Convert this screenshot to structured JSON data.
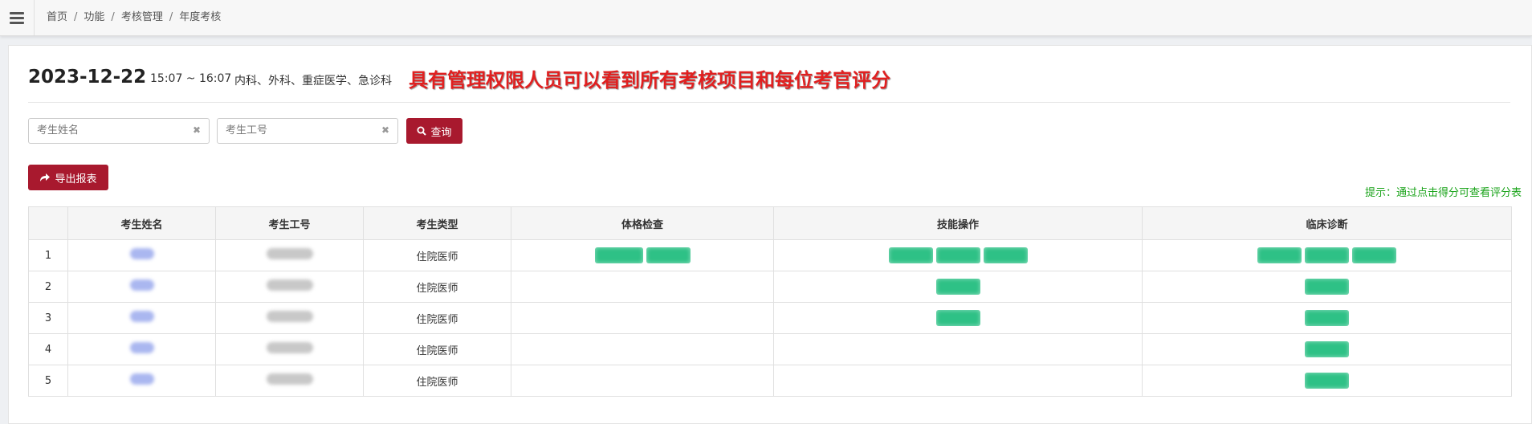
{
  "breadcrumb": [
    "首页",
    "功能",
    "考核管理",
    "年度考核"
  ],
  "exam": {
    "date": "2023-12-22",
    "time": "15:07 ~ 16:07",
    "departments": "内科、外科、重症医学、急诊科",
    "notice": "具有管理权限人员可以看到所有考核项目和每位考官评分"
  },
  "search": {
    "name_placeholder": "考生姓名",
    "id_placeholder": "考生工号",
    "query_label": "查询"
  },
  "export_label": "导出报表",
  "tip": "提示：通过点击得分可查看评分表",
  "table": {
    "headers": [
      "",
      "考生姓名",
      "考生工号",
      "考生类型",
      "体格检查",
      "技能操作",
      "临床诊断"
    ],
    "rows": [
      {
        "index": "1",
        "type": "住院医师",
        "physical": 2,
        "skills": 3,
        "clinical": 3
      },
      {
        "index": "2",
        "type": "住院医师",
        "physical": 0,
        "skills": 1,
        "clinical": 1
      },
      {
        "index": "3",
        "type": "住院医师",
        "physical": 0,
        "skills": 1,
        "clinical": 1
      },
      {
        "index": "4",
        "type": "住院医师",
        "physical": 0,
        "skills": 0,
        "clinical": 1
      },
      {
        "index": "5",
        "type": "住院医师",
        "physical": 0,
        "skills": 0,
        "clinical": 1
      }
    ]
  },
  "colors": {
    "primary": "#a8192e",
    "score_badge": "#2ec186",
    "notice": "#e02020",
    "tip": "#19a319"
  }
}
